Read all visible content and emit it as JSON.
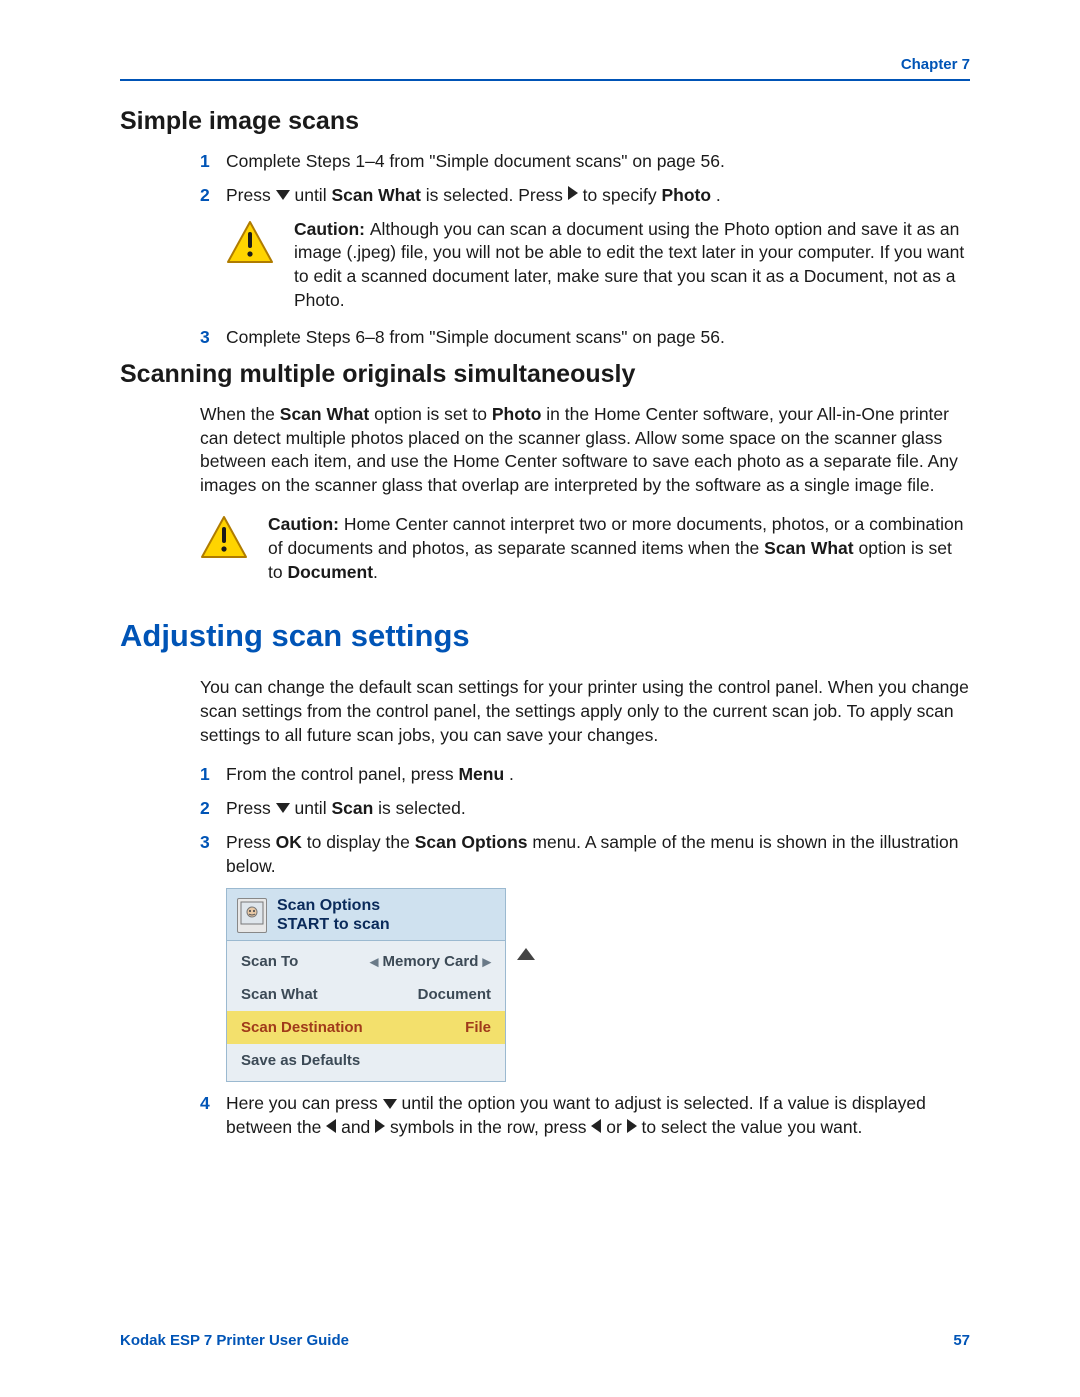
{
  "header": {
    "chapter": "Chapter 7"
  },
  "sectionA": {
    "title": "Simple image scans",
    "step1": "Complete Steps 1–4 from \"Simple document scans\" on page 56.",
    "step2_a": "Press ",
    "step2_b": " until ",
    "step2_scanwhat": "Scan What",
    "step2_c": " is selected. Press ",
    "step2_d": "  to specify ",
    "step2_photo": "Photo",
    "step2_e": ".",
    "caution_label": "Caution: ",
    "caution_body": "Although you can scan a document using the Photo option and save it as an image (.jpeg) file, you will not be able to edit the text later in your computer. If you want to edit a scanned document later, make sure that you scan it as a Document, not as a Photo.",
    "step3": "Complete Steps 6–8 from \"Simple document scans\" on page 56."
  },
  "sectionB": {
    "title": "Scanning multiple originals simultaneously",
    "para_a": "When the ",
    "para_scanwhat": "Scan What",
    "para_b": " option is set to ",
    "para_photo": "Photo",
    "para_c": " in the Home Center software, your All-in-One printer can detect multiple photos placed on the scanner glass. Allow some space on the scanner glass between each item, and use the Home Center software to save each photo as a separate file. Any images on the scanner glass that overlap are interpreted by the software as a single image file.",
    "caution_label": "Caution: ",
    "caution_a": "Home Center cannot interpret two or more documents, photos, or a combination of documents and photos, as separate scanned items when the ",
    "caution_scanwhat": "Scan What",
    "caution_b": " option is set to ",
    "caution_document": "Document",
    "caution_c": "."
  },
  "sectionC": {
    "title": "Adjusting scan settings",
    "intro": "You can change the default scan settings for your printer using the control panel. When you change scan settings from the control panel, the settings apply only to the current scan job. To apply scan settings to all future scan jobs, you can save your changes.",
    "step1_a": "From the control panel, press ",
    "step1_menu": "Menu",
    "step1_b": ".",
    "step2_a": "Press ",
    "step2_b": " until ",
    "step2_scan": "Scan",
    "step2_c": " is selected.",
    "step3_a": "Press ",
    "step3_ok": "OK",
    "step3_b": " to display the ",
    "step3_scanoptions": "Scan Options",
    "step3_c": " menu. A sample of the menu is shown in the illustration below.",
    "menu": {
      "title1": "Scan Options",
      "title2": "START to scan",
      "row1_label": "Scan To",
      "row1_value": "Memory Card",
      "row2_label": "Scan What",
      "row2_value": "Document",
      "row3_label": "Scan Destination",
      "row3_value": "File",
      "row4_label": "Save as Defaults"
    },
    "step4_a": "Here you can press ",
    "step4_b": " until the option you want to adjust is selected. If a value is displayed between the ",
    "step4_c": " and ",
    "step4_d": " symbols in the row, press ",
    "step4_e": " or ",
    "step4_f": " to select the value you want."
  },
  "footer": {
    "left": "Kodak ESP 7 Printer User Guide",
    "right": "57"
  }
}
